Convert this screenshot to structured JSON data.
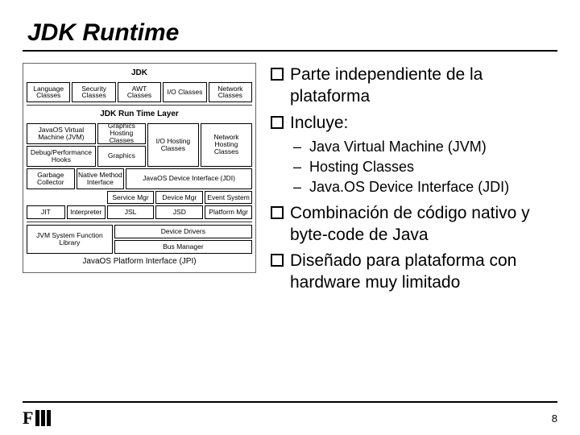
{
  "title": "JDK Runtime",
  "diagram": {
    "hdr_jdk": "JDK",
    "r1": [
      "Language Classes",
      "Security Classes",
      "AWT Classes",
      "I/O Classes",
      "Network Classes"
    ],
    "hdr_rt": "JDK Run Time Layer",
    "jvm": "JavaOS Virtual Machine (JVM)",
    "dbg": "Debug/Performance Hooks",
    "gfx_host": "Graphics Hosting Classes",
    "gfx": "Graphics",
    "io_host": "I/O Hosting Classes",
    "net_host": "Network Hosting Classes",
    "jdi": "JavaOS Device Interface (JDI)",
    "gc": "Garbage Collector",
    "nmi": "Native Method Interface",
    "svc": "Service Mgr",
    "dev": "Device Mgr",
    "evt": "Event System",
    "jit": "JIT",
    "interp": "Interpreter",
    "jsl": "JSL",
    "jsd": "JSD",
    "plat": "Platform Mgr",
    "jsfl": "JVM System Function Library",
    "drv": "Device Drivers",
    "bus": "Bus Manager",
    "jpi": "JavaOS Platform Interface (JPI)"
  },
  "bullets": {
    "b1": "Parte independiente de la plataforma",
    "b2": "Incluye:",
    "s1": "Java Virtual Machine (JVM)",
    "s2": "Hosting Classes",
    "s3": "Java.OS Device Interface (JDI)",
    "b3": "Combinación de código nativo y byte-code de Java",
    "b4": "Diseñado para plataforma con hardware muy limitado"
  },
  "footer": {
    "logo_letter": "F",
    "page": "8"
  }
}
